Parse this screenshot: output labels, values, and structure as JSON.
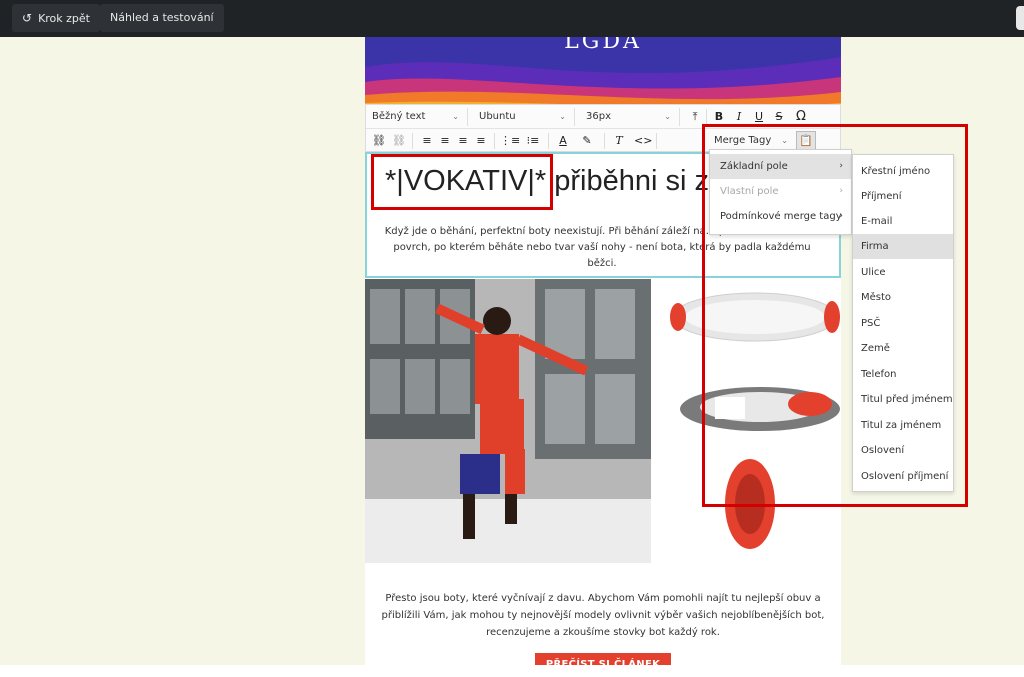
{
  "topbar": {
    "undo_label": "Krok zpět",
    "preview_label": "Náhled a testování"
  },
  "email": {
    "logo_text": "LGDA",
    "headline_tag": "*|VOKATIV|*",
    "headline_rest": "přiběhni si z",
    "intro_text": "Když jde o běhání, perfektní boty neexistují. Při běhání záleží na… postava, vaše váha, povrch, po kterém běháte nebo tvar vaší nohy - není bota, která by padla každému běžci.",
    "body_text": "Přesto jsou boty, které vyčnívají z davu. Abychom Vám pomohli najít tu nejlepší obuv a přiblížili Vám, jak mohou ty nejnovější modely ovlivnit výběr vašich nejoblíbenějších bot, recenzujeme a zkoušíme stovky bot každý rok.",
    "cta_label": "PŘEČÍST SI ČLÁNEK"
  },
  "editor_toolbar": {
    "style_select": "Běžný text",
    "font_select": "Ubuntu",
    "size_select": "36px",
    "merge_tags_select": "Merge Tagy"
  },
  "merge_menu": {
    "items": [
      {
        "label": "Základní pole",
        "state": "active"
      },
      {
        "label": "Vlastní pole",
        "state": "disabled"
      },
      {
        "label": "Podmínkové merge tagy",
        "state": "normal"
      }
    ]
  },
  "basic_fields_menu": {
    "items": [
      {
        "label": "Křestní jméno"
      },
      {
        "label": "Příjmení"
      },
      {
        "label": "E-mail"
      },
      {
        "label": "Firma"
      },
      {
        "label": "Ulice"
      },
      {
        "label": "Město"
      },
      {
        "label": "PSČ"
      },
      {
        "label": "Země"
      },
      {
        "label": "Telefon"
      },
      {
        "label": "Titul před jménem"
      },
      {
        "label": "Titul za jménem"
      },
      {
        "label": "Oslovení"
      },
      {
        "label": "Oslovení příjmení"
      }
    ],
    "hovered": "Firma"
  },
  "colors": {
    "topbar": "#202326",
    "canvas_bg": "#f6f6e6",
    "accent_red": "#e4402e",
    "highlight_red": "#d40000",
    "selection_cyan": "#87d3dc"
  },
  "icons": {
    "undo": "undo-icon",
    "insert": "insert-icon",
    "bold": "bold-icon",
    "italic": "italic-icon",
    "underline": "underline-icon",
    "strike": "strikethrough-icon",
    "omega": "special-char-icon",
    "link": "link-icon",
    "unlink": "unlink-icon",
    "align_left": "align-left-icon",
    "align_center": "align-center-icon",
    "align_right": "align-right-icon",
    "justify": "align-justify-icon",
    "ordered_list": "ordered-list-icon",
    "bullet_list": "bullet-list-icon",
    "text_color": "text-color-icon",
    "highlight": "highlight-icon",
    "clear_format": "clear-format-icon",
    "code": "code-icon",
    "clipboard": "clipboard-icon"
  }
}
